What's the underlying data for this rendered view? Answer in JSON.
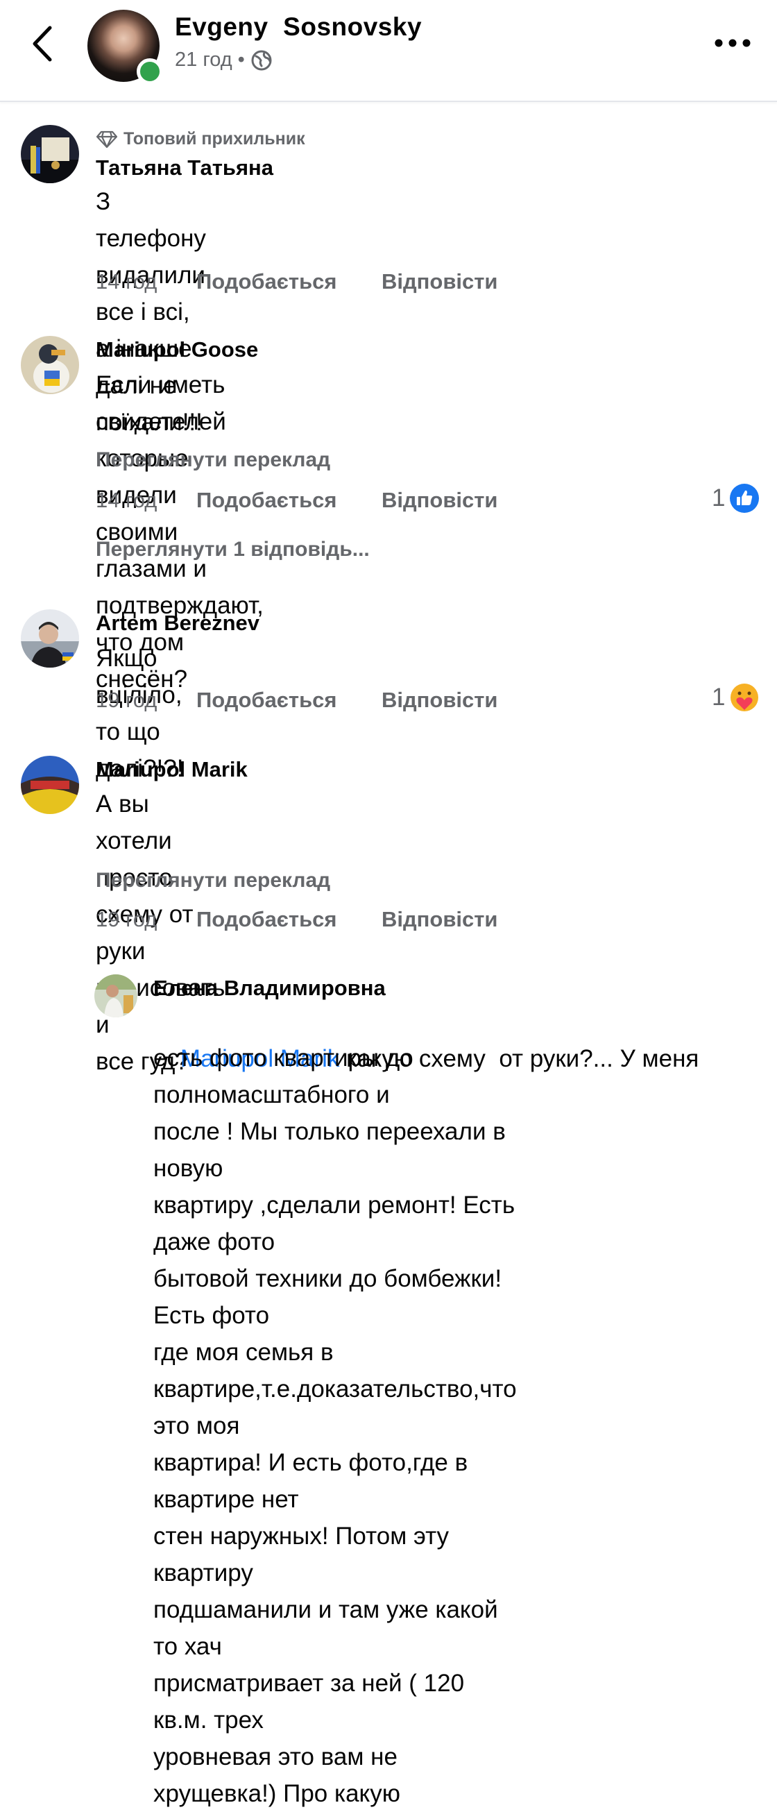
{
  "header": {
    "author_name": "Evgeny  Sosnovsky",
    "time": "21 год",
    "separator": "•",
    "back_icon": "chevron-left-icon",
    "privacy_icon": "globe-icon",
    "more_icon": "more-horizontal-icon"
  },
  "comments": [
    {
      "badge": "Топовий прихильник",
      "name": "Татьяна Татьяна",
      "text": "З телефону видалили все і всі, а інакше далі не\nпоїхали!!!",
      "time": "14 год",
      "like": "Подобається",
      "reply": "Відповісти"
    },
    {
      "name": "Mariupol Goose",
      "text": "Если иметь свидетелей которые видели своими\nглазами и подтверждают, что дом снесён?",
      "translate": "Переглянути переклад",
      "time": "14 год",
      "like": "Подобається",
      "reply": "Відповісти",
      "reaction_count": "1",
      "reaction_icon": "like-icon",
      "view_replies": "Переглянути 1 відповідь..."
    },
    {
      "name": "Artem Bereznev",
      "text": "Якщо вціліло, то що далі?!?!",
      "time": "19 год",
      "like": "Подобається",
      "reply": "Відповісти",
      "reaction_count": "1",
      "reaction_icon": "care-icon"
    },
    {
      "name": "Mariupol Marik",
      "text": "А вы хотели просто схему от руки нарисовать и\nвсе гуд?",
      "translate": "Переглянути переклад",
      "time": "19 год",
      "like": "Подобається",
      "reply": "Відповісти"
    }
  ],
  "reply": {
    "name": "Елена Владимировна",
    "mention": "Mariupol Marik",
    "text_first": " какую схему  от руки?... У меня",
    "text_rest": "есть фото квартиры  до полномасштабного и\nпосле ! Мы только переехали в новую\nквартиру ,сделали ремонт! Есть даже фото\nбытовой техники до  бомбежки!  Есть фото\nгде моя семья в\nквартире,т.е.доказательство,что это моя\nквартира! И есть фото,где в квартире нет\nстен наружных! Потом эту квартиру\nподшаманили и там уже какой то хач\nприсматривает за ней ( 120 кв.м. трех\nуровневая это вам не хрущевка!)  Про какую"
  },
  "colors": {
    "text": "#050505",
    "secondary": "#65676b",
    "link": "#1877f2",
    "online": "#31a24c"
  }
}
